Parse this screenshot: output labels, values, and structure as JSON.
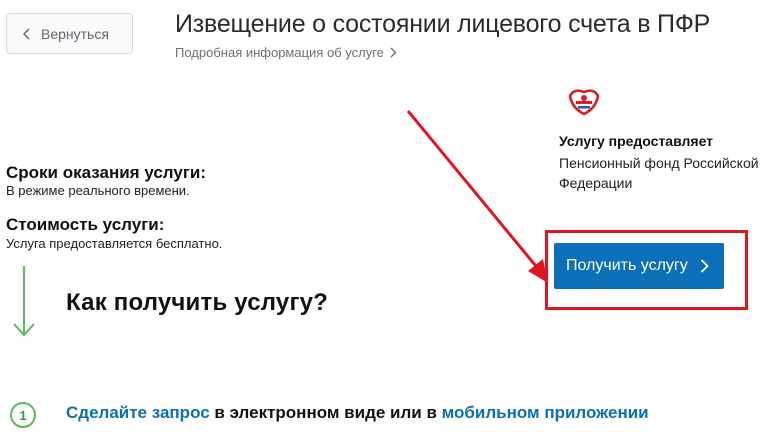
{
  "header": {
    "back_label": "Вернуться",
    "title": "Извещение о состоянии лицевого счета в ПФР",
    "subtitle_link": "Подробная информация об услуге"
  },
  "provider": {
    "label": "Услугу предоставляет",
    "name": "Пенсионный фонд Российской Федерации"
  },
  "service_info": {
    "time_heading": "Сроки оказания услуги:",
    "time_text": "В режиме реального времени.",
    "cost_heading": "Стоимость услуги:",
    "cost_text": "Услуга предоставляется бесплатно."
  },
  "how_to": {
    "title": "Как получить услугу?",
    "cta_label": "Получить услугу"
  },
  "steps": [
    {
      "number": "1",
      "link1": "Сделайте запрос",
      "text1": " в электронном виде или в ",
      "link2": "мобильном приложении"
    }
  ],
  "colors": {
    "primary": "#0b6fba",
    "annotation_red": "#e0161e",
    "step_green": "#5cb85c"
  },
  "icons": {
    "back": "chevron-left-icon",
    "subtitle": "chevron-right-icon",
    "cta": "chevron-right-icon",
    "logo": "pfr-logo-icon"
  }
}
